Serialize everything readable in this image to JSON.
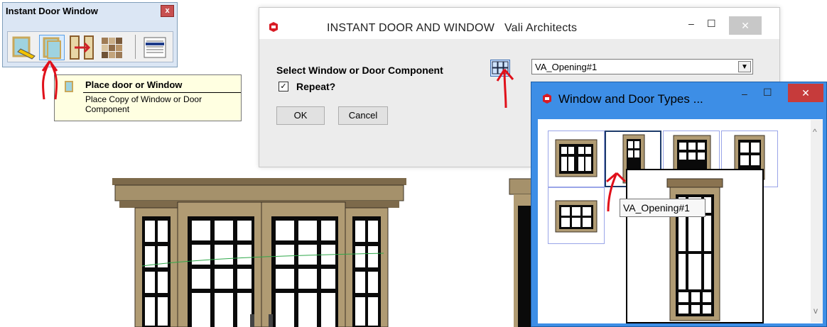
{
  "toolbar": {
    "title": "Instant Door Window",
    "close_label": "x",
    "icons": [
      "pencil-window-icon",
      "place-window-icon",
      "door-arrow-icon",
      "material-swatch-icon",
      "list-icon"
    ]
  },
  "tooltip": {
    "title": "Place door or Window",
    "description": "Place Copy of Window or Door Component"
  },
  "dialog": {
    "title": "INSTANT DOOR AND WINDOW   Vali Architects",
    "select_label": "Select Window or Door Component",
    "selected_component": "VA_Opening#1",
    "repeat_label": "Repeat?",
    "repeat_checked": "✓",
    "ok_label": "OK",
    "cancel_label": "Cancel",
    "minimize": "–",
    "maximize": "☐",
    "close": "✕"
  },
  "types_window": {
    "title": "Window and Door Types ...",
    "minimize": "–",
    "maximize": "☐",
    "close": "✕",
    "tooltip": "VA_Opening#1",
    "scroll_up": "^",
    "scroll_down": "v"
  },
  "colors": {
    "wood": "#8a7350",
    "wood_light": "#b9a57c",
    "accent_blue": "#3d8ee6",
    "annotation_red": "#e0101a"
  }
}
